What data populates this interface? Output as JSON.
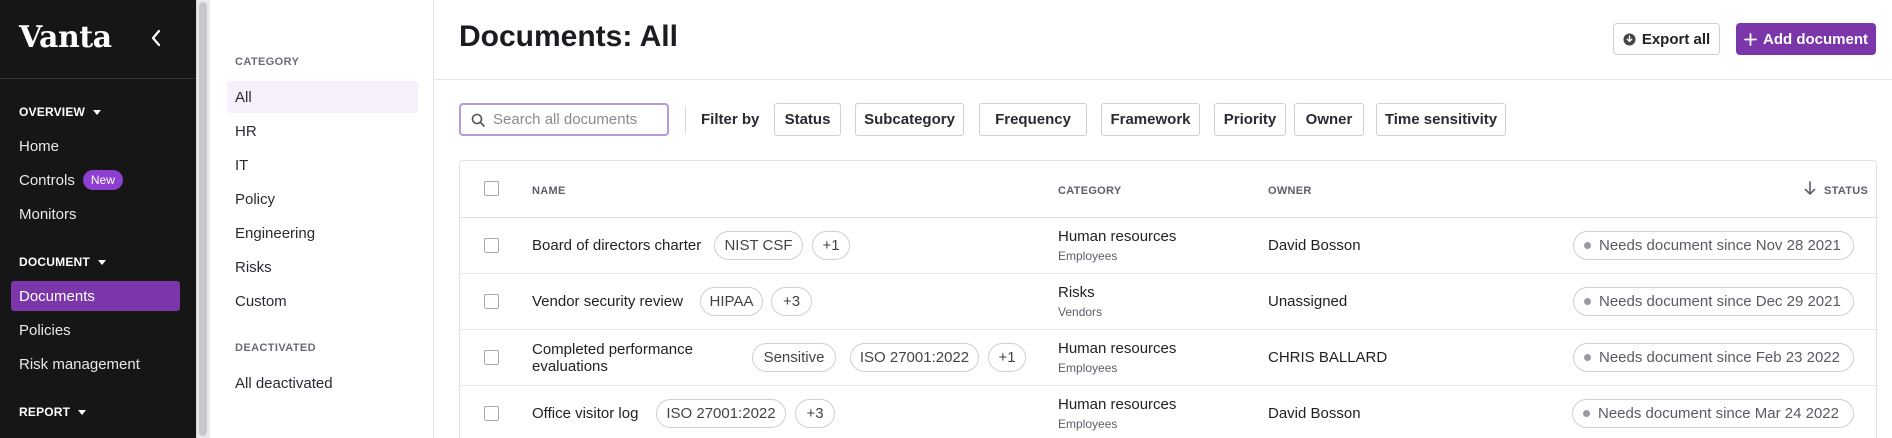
{
  "nav": {
    "logo": "Vanta",
    "sections": [
      {
        "label": "OVERVIEW"
      },
      {
        "label": "DOCUMENT"
      },
      {
        "label": "REPORT"
      }
    ],
    "items": {
      "home": "Home",
      "controls": "Controls",
      "controls_badge": "New",
      "monitors": "Monitors",
      "documents": "Documents",
      "policies": "Policies",
      "risk_management": "Risk management"
    }
  },
  "categories": {
    "heading": "CATEGORY",
    "items": [
      "All",
      "HR",
      "IT",
      "Policy",
      "Engineering",
      "Risks",
      "Custom"
    ],
    "deactivated_heading": "DEACTIVATED",
    "deactivated_item": "All deactivated"
  },
  "header": {
    "title": "Documents: All",
    "export_label": "Export all",
    "add_label": "Add document"
  },
  "toolbar": {
    "search_placeholder": "Search all documents",
    "filter_label": "Filter by",
    "filters": [
      "Status",
      "Subcategory",
      "Frequency",
      "Framework",
      "Priority",
      "Owner",
      "Time sensitivity"
    ]
  },
  "table": {
    "columns": {
      "name": "NAME",
      "category": "CATEGORY",
      "owner": "OWNER",
      "status": "STATUS"
    },
    "rows": [
      {
        "name_line1": "Board of directors charter",
        "name_line2": "",
        "tags": [
          "NIST CSF",
          "+1"
        ],
        "category": "Human resources",
        "subcategory": "Employees",
        "owner": "David Bosson",
        "status": "Needs document since Nov 28 2021"
      },
      {
        "name_line1": "Vendor security review",
        "name_line2": "",
        "tags": [
          "HIPAA",
          "+3"
        ],
        "category": "Risks",
        "subcategory": "Vendors",
        "owner": "Unassigned",
        "status": "Needs document since Dec 29 2021"
      },
      {
        "name_line1": "Completed performance",
        "name_line2": "evaluations",
        "tags": [
          "Sensitive",
          "ISO 27001:2022",
          "+1"
        ],
        "category": "Human resources",
        "subcategory": "Employees",
        "owner": "CHRIS BALLARD",
        "status": "Needs document since Feb 23 2022"
      },
      {
        "name_line1": "Office visitor log",
        "name_line2": "",
        "tags": [
          "ISO 27001:2022",
          "+3"
        ],
        "category": "Human resources",
        "subcategory": "Employees",
        "owner": "David Bosson",
        "status": "Needs document since Mar 24 2022"
      }
    ]
  }
}
